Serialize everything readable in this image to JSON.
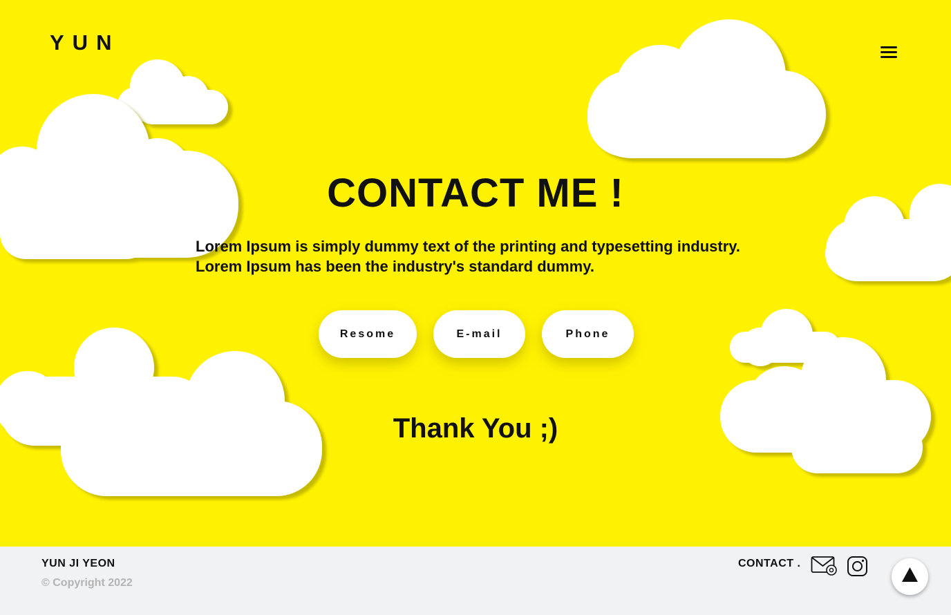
{
  "header": {
    "logo": "YUN",
    "menu_icon": "hamburger-menu-icon"
  },
  "main": {
    "title": "CONTACT ME !",
    "description": "Lorem Ipsum is simply dummy text of the printing and typesetting industry. Lorem Ipsum has been the industry's standard dummy.",
    "buttons": {
      "resume": "Resome",
      "email": "E-mail",
      "phone": "Phone"
    },
    "thanks": "Thank You ;)"
  },
  "footer": {
    "name": "YUN JI YEON",
    "copyright": "© Copyright 2022",
    "contact_label": "CONTACT .",
    "icons": [
      "mail-icon",
      "instagram-icon"
    ],
    "scroll_top_icon": "arrow-up-icon"
  },
  "colors": {
    "background": "#fff200",
    "footer": "#f1f2f4",
    "cloud": "#ffffff",
    "text": "#111111"
  }
}
